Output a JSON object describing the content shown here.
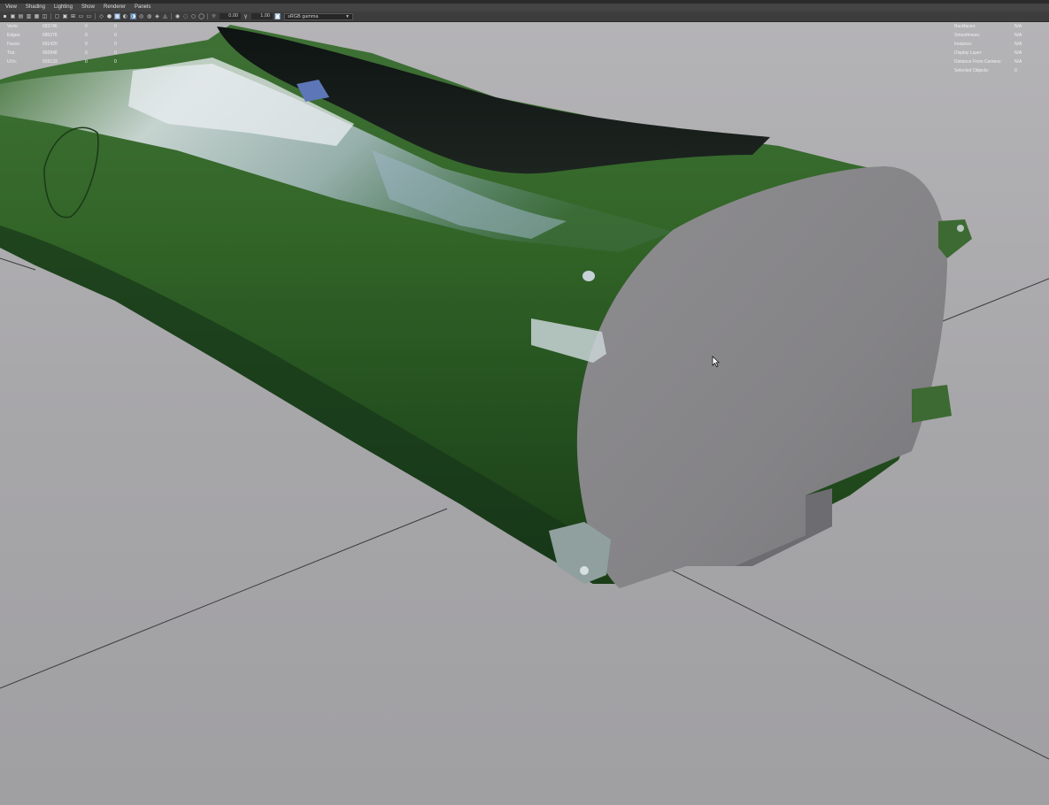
{
  "menubar": {
    "items": [
      "View",
      "Shading",
      "Lighting",
      "Show",
      "Renderer",
      "Panels"
    ]
  },
  "toolbar": {
    "exposure_value": "0.00",
    "gamma_value": "1.00",
    "color_space": "sRGB gamma"
  },
  "hud_left": {
    "rows": [
      {
        "label": "Verts:",
        "value": "683746",
        "selected": "0",
        "components": "0"
      },
      {
        "label": "Edges:",
        "value": "685276",
        "selected": "0",
        "components": "0"
      },
      {
        "label": "Faces:",
        "value": "691420",
        "selected": "0",
        "components": "0"
      },
      {
        "label": "Tris:",
        "value": "992848",
        "selected": "0",
        "components": "0"
      },
      {
        "label": "UVs:",
        "value": "559133",
        "selected": "0",
        "components": "0"
      }
    ]
  },
  "hud_right": {
    "rows": [
      {
        "label": "Backfaces:",
        "value": "N/A"
      },
      {
        "label": "Smoothness:",
        "value": "N/A"
      },
      {
        "label": "Instance:",
        "value": "N/A"
      },
      {
        "label": "Display Layer:",
        "value": "N/A"
      },
      {
        "label": "Distance From Camera:",
        "value": "N/A"
      },
      {
        "label": "Selected Objects:",
        "value": "0"
      }
    ]
  },
  "colors": {
    "viewport_background": "#a9a8ab",
    "body_paint": "#2f5a2a",
    "cap_grey": "#8a898c",
    "toolbar_highlight": "#5d7ea6"
  }
}
